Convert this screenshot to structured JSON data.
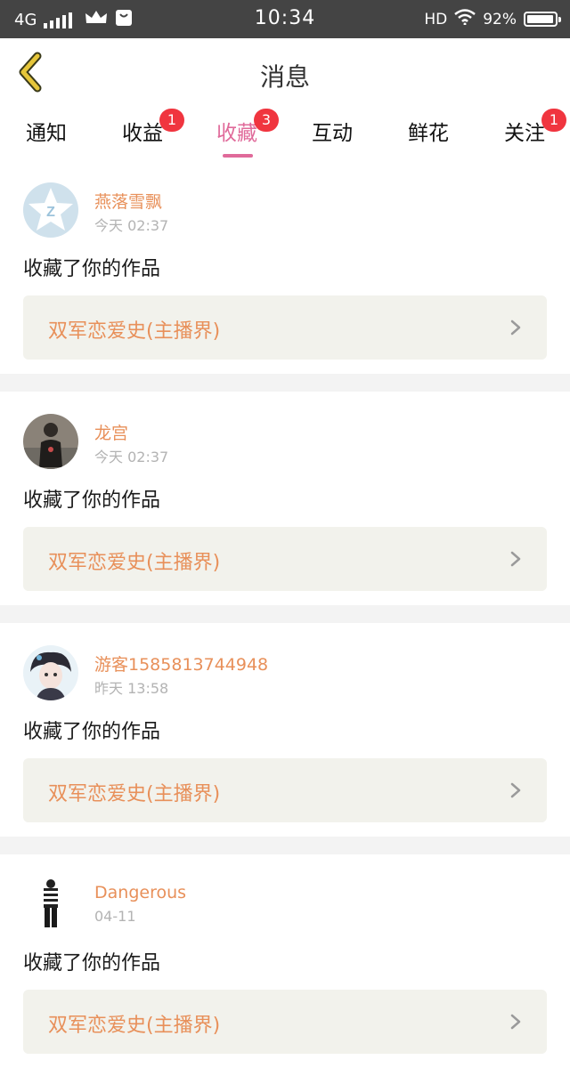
{
  "status_bar": {
    "network": "4G",
    "time": "10:34",
    "hd": "HD",
    "battery": "92%"
  },
  "header": {
    "title": "消息",
    "back_icon": "chevron-left-icon"
  },
  "tabs": [
    {
      "label": "通知",
      "badge": ""
    },
    {
      "label": "收益",
      "badge": "1"
    },
    {
      "label": "收藏",
      "badge": "3",
      "active": true
    },
    {
      "label": "互动",
      "badge": ""
    },
    {
      "label": "鲜花",
      "badge": ""
    },
    {
      "label": "关注",
      "badge": "1"
    }
  ],
  "messages": [
    {
      "username": "燕落雪飘",
      "time": "今天 02:37",
      "action": "收藏了你的作品",
      "work_title": "双军恋爱史(主播界)"
    },
    {
      "username": "龙宫",
      "time": "今天 02:37",
      "action": "收藏了你的作品",
      "work_title": "双军恋爱史(主播界)"
    },
    {
      "username": "游客1585813744948",
      "time": "昨天 13:58",
      "action": "收藏了你的作品",
      "work_title": "双军恋爱史(主播界)"
    },
    {
      "username": "Dangerous",
      "time": "04-11",
      "action": "收藏了你的作品",
      "work_title": "双军恋爱史(主播界)"
    }
  ],
  "colors": {
    "accent": "#e06a9a",
    "username": "#e8905a",
    "badge": "#f0353f",
    "back_icon": "#e6c63a",
    "work_bg": "#f2f2ec"
  }
}
